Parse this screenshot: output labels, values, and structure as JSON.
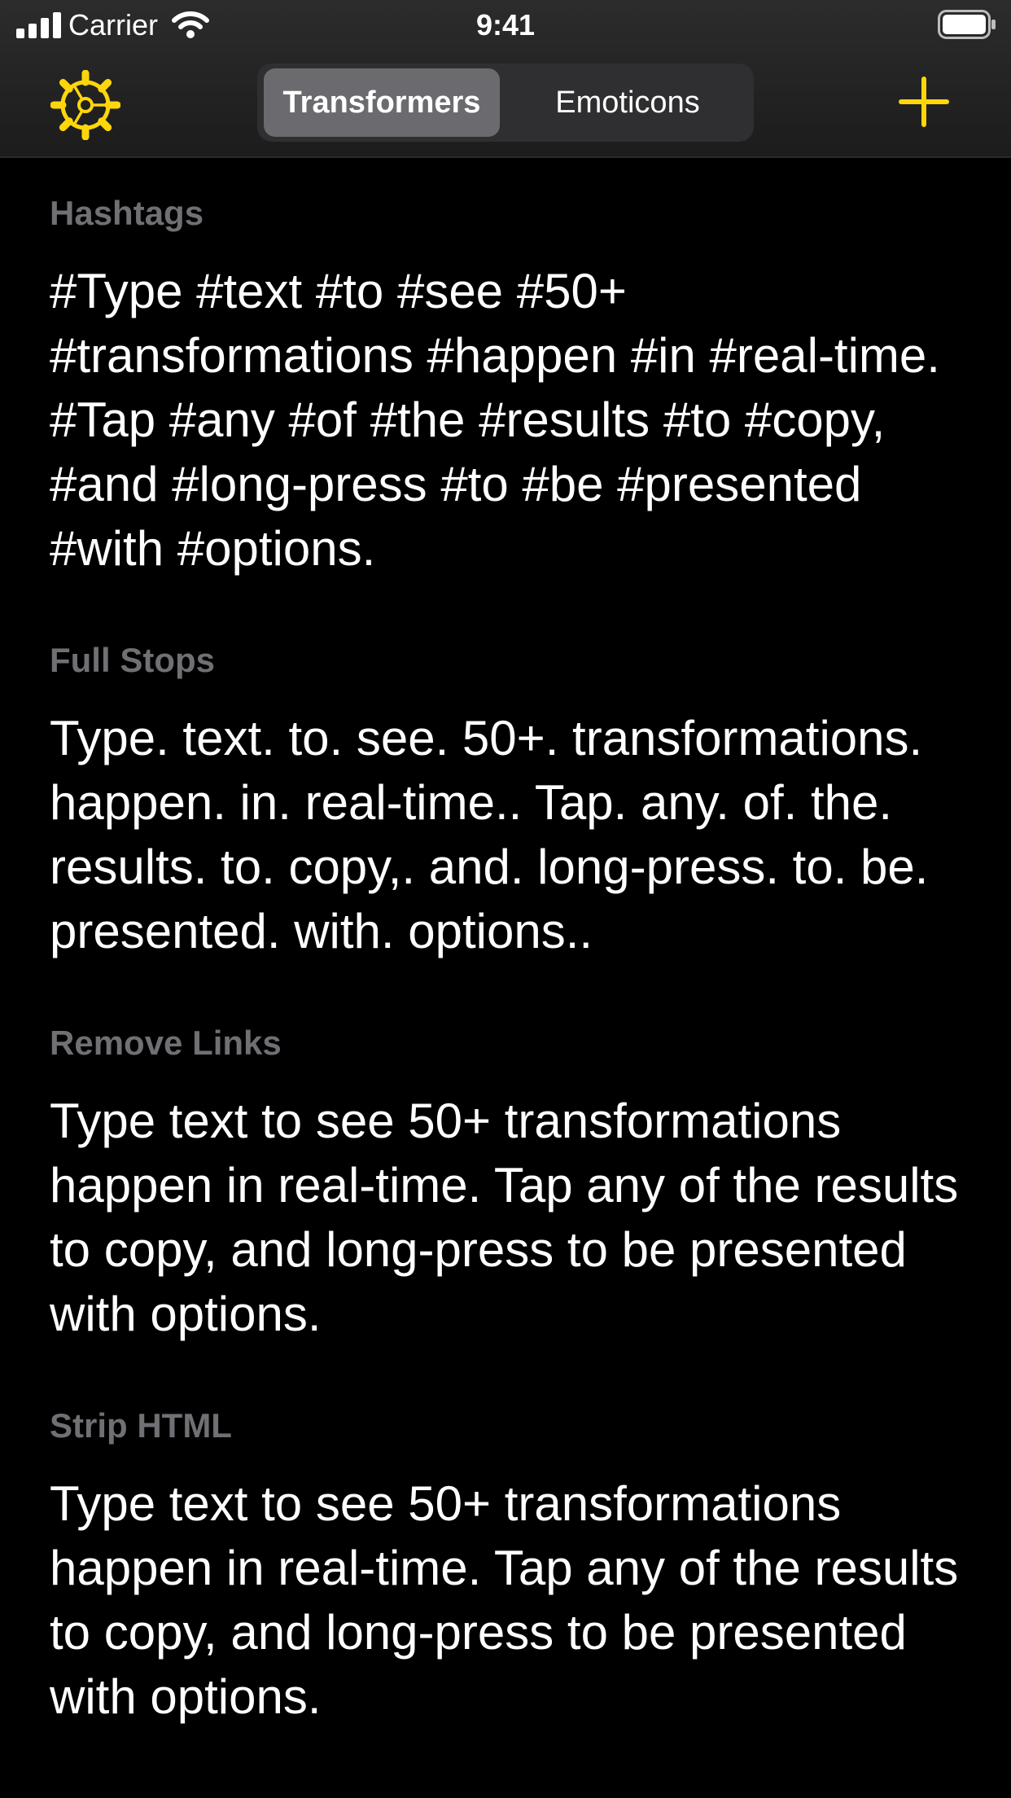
{
  "status_bar": {
    "carrier": "Carrier",
    "time": "9:41"
  },
  "nav": {
    "settings_icon": "gear-icon",
    "add_icon": "plus-icon",
    "tabs": [
      {
        "label": "Transformers",
        "selected": true
      },
      {
        "label": "Emoticons",
        "selected": false
      }
    ],
    "accent_color": "#FFD60A"
  },
  "results": [
    {
      "title": "Hashtags",
      "text": "#Type #text #to #see #50+ #transformations #happen #in #real-time. #Tap #any #of #the #results #to #copy, #and #long-press #to #be #presented #with #options."
    },
    {
      "title": "Full Stops",
      "text": "Type. text. to. see. 50+. transformations. happen. in. real-time.. Tap. any. of. the. results. to. copy,. and. long-press. to. be. presented. with. options.."
    },
    {
      "title": "Remove Links",
      "text": "Type text to see 50+ transformations happen in real-time. Tap any of the results to copy, and long-press to be presented with options."
    },
    {
      "title": "Strip HTML",
      "text": "Type text to see 50+ transformations happen in real-time. Tap any of the results to copy, and long-press to be presented with options."
    }
  ]
}
